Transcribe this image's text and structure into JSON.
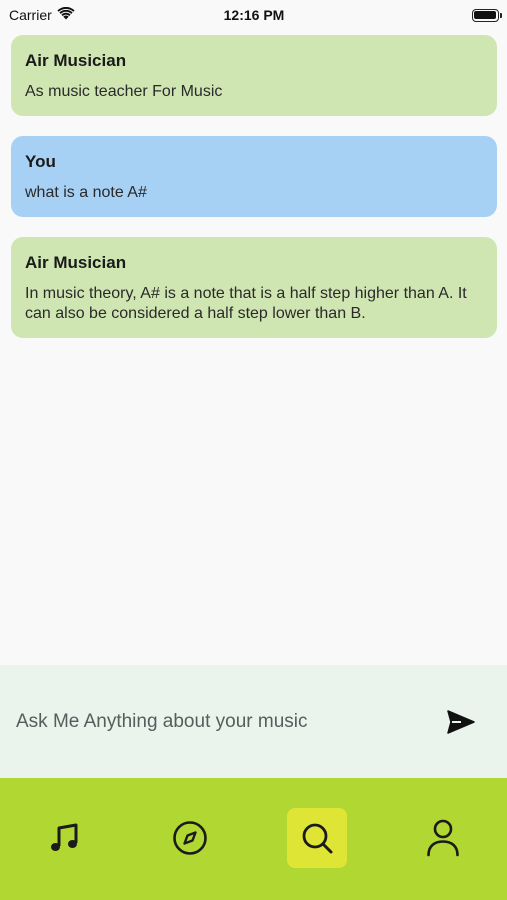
{
  "status_bar": {
    "carrier": "Carrier",
    "time": "12:16 PM"
  },
  "messages": [
    {
      "sender": "Air Musician",
      "role": "ai",
      "text": "As music teacher For Music"
    },
    {
      "sender": "You",
      "role": "user",
      "text": "what is a note A#"
    },
    {
      "sender": "Air Musician",
      "role": "ai",
      "text": "In music theory, A# is a note that is a half step higher than A. It can also be considered a half step lower than B."
    }
  ],
  "input": {
    "placeholder": "Ask Me Anything about your music",
    "value": ""
  },
  "nav": {
    "items": [
      {
        "icon": "music-note-icon",
        "active": false
      },
      {
        "icon": "compass-icon",
        "active": false
      },
      {
        "icon": "search-icon",
        "active": true
      },
      {
        "icon": "user-icon",
        "active": false
      }
    ]
  },
  "colors": {
    "ai_bubble": "#d0e6b2",
    "user_bubble": "#a6d0f4",
    "nav_bg": "#b1d733",
    "nav_active": "#dfe535",
    "input_bg": "#eaf4ed"
  }
}
